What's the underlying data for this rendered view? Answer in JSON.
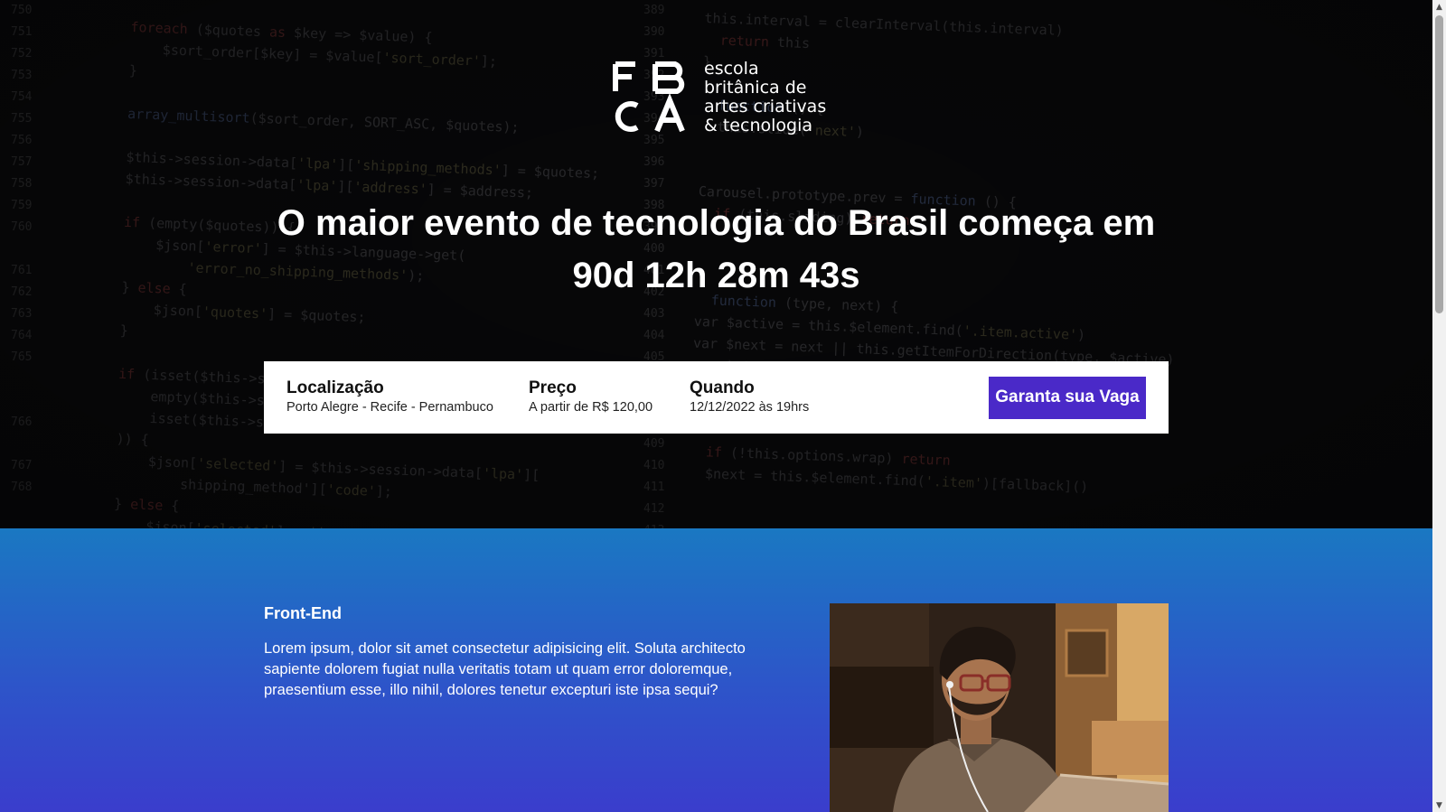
{
  "brand": {
    "name_lines": [
      "escola",
      "britânica de",
      "artes criativas",
      "& tecnologia"
    ],
    "logo_icon": "ebac-logo-icon"
  },
  "hero": {
    "headline": "O maior evento de tecnologia do Brasil começa em",
    "countdown": "90d 12h 28m 43s"
  },
  "info": {
    "location_label": "Localização",
    "location_value": "Porto Alegre - Recife - Pernambuco",
    "price_label": "Preço",
    "price_value": "A partir de R$ 120,00",
    "when_label": "Quando",
    "when_value": "12/12/2022 às 19hrs",
    "cta_label": "Garanta sua Vaga"
  },
  "section": {
    "title": "Front-End",
    "text": "Lorem ipsum, dolor sit amet consectetur adipisicing elit. Soluta architecto sapiente dolorem fugiat nulla veritatis totam ut quam error doloremque, praesentium esse, illo nihil, dolores tenetur excepturi iste ipsa sequi?"
  },
  "colors": {
    "accent": "#4a29c8",
    "section_top": "#1a78c2",
    "section_bottom": "#3a3dcc"
  }
}
